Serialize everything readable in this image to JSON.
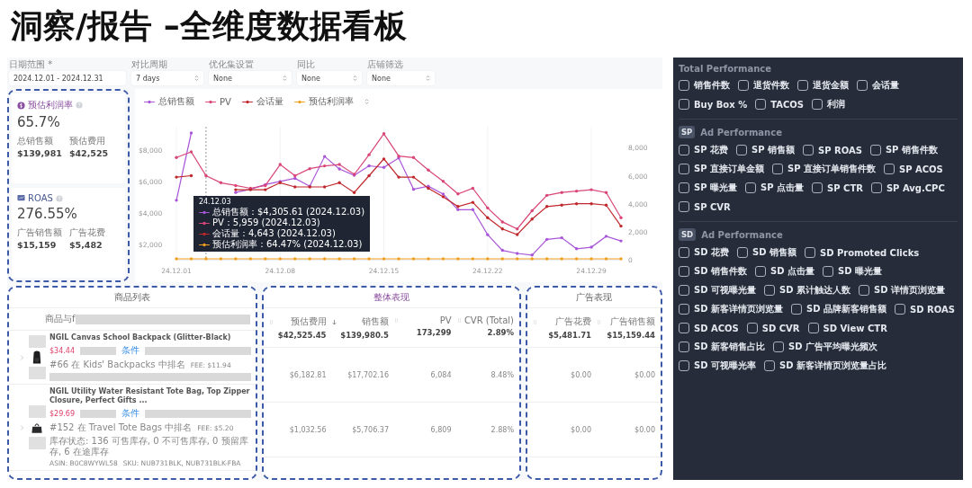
{
  "title": "洞察/报告 –全维度数据看板",
  "filters": [
    {
      "label": "日期范围 *",
      "value": "2024.12.01 - 2024.12.31",
      "dropdown": false
    },
    {
      "label": "对比周期",
      "value": "7 days",
      "dropdown": true
    },
    {
      "label": "优化集设置",
      "value": "None",
      "dropdown": true
    },
    {
      "label": "同比",
      "value": "None",
      "dropdown": true
    },
    {
      "label": "店铺筛选",
      "value": "None",
      "dropdown": true
    }
  ],
  "kpis": [
    {
      "kind": "profit",
      "title": "预估利润率",
      "value": "65.7%",
      "subs": [
        {
          "label": "总销售额",
          "value": "$139,981"
        },
        {
          "label": "预估费用",
          "value": "$42,525"
        }
      ]
    },
    {
      "kind": "roas",
      "title": "ROAS",
      "value": "276.55%",
      "subs": [
        {
          "label": "广告销售额",
          "value": "$15,159"
        },
        {
          "label": "广告花费",
          "value": "$5,482"
        }
      ]
    }
  ],
  "chart": {
    "tooltip": {
      "title": "24.12.03",
      "lines": [
        "总销售额：$4,305.61 (2024.12.03)",
        "PV：5,959 (2024.12.03)",
        "会话量：4,643 (2024.12.03)",
        "预估利润率：64.47% (2024.12.03)"
      ]
    },
    "chart_data": {
      "type": "line",
      "categories": [
        "24.12.01",
        null,
        null,
        null,
        null,
        null,
        null,
        "24.12.08",
        null,
        null,
        null,
        null,
        null,
        null,
        "24.12.15",
        null,
        null,
        null,
        null,
        null,
        null,
        "24.12.22",
        null,
        null,
        null,
        null,
        null,
        null,
        "24.12.29",
        null,
        null
      ],
      "grid": true,
      "ylim": [
        1000,
        9500
      ],
      "yticks": [
        {
          "value": 2000,
          "label": "$2,000"
        },
        {
          "value": 4000,
          "label": "$4,000"
        },
        {
          "value": 6000,
          "label": "$6,000"
        },
        {
          "value": 8000,
          "label": "$8,000"
        }
      ],
      "y2lim": [
        0,
        9500
      ],
      "y2ticks": [
        {
          "value": 0,
          "label": "0"
        },
        {
          "value": 2000,
          "label": "2,000"
        },
        {
          "value": 4000,
          "label": "4,000"
        },
        {
          "value": 6000,
          "label": "6,000"
        },
        {
          "value": 8000,
          "label": "8,000"
        }
      ],
      "series": [
        {
          "name": "总销售额",
          "color": "#a855d8",
          "values": [
            4800,
            9100,
            null,
            null,
            5300,
            5500,
            5800,
            6000,
            6200,
            5700,
            7600,
            6800,
            6400,
            7000,
            6900,
            7500,
            5500,
            5700,
            5200,
            4200,
            4200,
            2600,
            1600,
            1400,
            1300,
            2300,
            2400,
            1700,
            1800,
            2500,
            2200
          ]
        },
        {
          "name": "PV",
          "color": "#d9467a",
          "axis": "y2",
          "values": [
            7300,
            7700,
            6000,
            5500,
            5300,
            5100,
            5300,
            6800,
            6000,
            6500,
            6700,
            6800,
            6100,
            7500,
            9000,
            7400,
            7300,
            6400,
            5600,
            4700,
            5100,
            3700,
            2700,
            2200,
            3500,
            4600,
            4800,
            4900,
            5000,
            4800,
            3000
          ]
        },
        {
          "name": "会话量",
          "color": "#c0282d",
          "axis": "y2",
          "values": [
            5900,
            6000,
            null,
            null,
            5000,
            5000,
            5000,
            5500,
            5200,
            5200,
            5200,
            5500,
            4800,
            6000,
            7200,
            5900,
            5900,
            5100,
            4500,
            3800,
            4100,
            3000,
            2200,
            1800,
            2900,
            3800,
            3900,
            4000,
            4000,
            3900,
            2400
          ]
        },
        {
          "name": "预估利润率",
          "color": "#f0a020",
          "axis": "y2",
          "values": [
            65,
            65,
            65,
            65,
            65,
            65,
            65,
            65,
            65,
            65,
            65,
            65,
            65,
            65,
            65,
            65,
            65,
            65,
            65,
            65,
            65,
            65,
            65,
            65,
            65,
            65,
            65,
            65,
            65,
            65,
            65
          ]
        }
      ]
    }
  },
  "products": {
    "title": "商品列表",
    "column": "商品与f",
    "rows": [
      {
        "kind": "backpack",
        "name": "NGIL Canvas School Backpack (Glitter-Black)",
        "price": "$34.44",
        "tag": "条件",
        "rank": "#66 在 Kids' Backpacks 中排名",
        "fee": "FEE: $11.94"
      },
      {
        "kind": "tote",
        "name": "NGIL Utility Water Resistant Tote Bag, Top Zipper Closure, Perfect Gifts ...",
        "price": "$29.69",
        "tag": "条件",
        "rank": "#152 在 Travel Tote Bags 中排名",
        "fee": "FEE: $5.20",
        "stock": "库存状态: 136 可售库存, 0 不可售库存, 0 预留库存, 6 在途库存",
        "asin": "ASIN: B0C8WYWL58",
        "sku": "SKU: NUB731BLK, NUB731BLK-FBA"
      }
    ]
  },
  "overall": {
    "title": "整体表现",
    "columns": [
      {
        "label": "预估费用",
        "total": "$42,525.45",
        "sorted": false
      },
      {
        "label": "销售额",
        "total": "$139,980.5",
        "sorted": true
      },
      {
        "label": "PV",
        "total": "173,299",
        "sorted": false
      },
      {
        "label": "CVR (Total)",
        "total": "2.89%",
        "sorted": false
      }
    ],
    "rows": [
      [
        "$6,182.81",
        "$17,702.16",
        "6,084",
        "8.48%"
      ],
      [
        "$1,032.56",
        "$5,706.37",
        "6,809",
        "2.88%"
      ]
    ]
  },
  "ads": {
    "title": "广告表现",
    "columns": [
      {
        "label": "广告花费",
        "total": "$5,481.71",
        "sorted": false
      },
      {
        "label": "广告销售额",
        "total": "$15,159.44",
        "sorted": false
      }
    ],
    "rows": [
      [
        "$0.00",
        "$0.00"
      ],
      [
        "$0.00",
        "$0.00"
      ]
    ]
  },
  "panel": [
    {
      "title": "Total Performance",
      "items": [
        {
          "label": "销售件数",
          "checked": false
        },
        {
          "label": "退货件数",
          "checked": false
        },
        {
          "label": "退货金额",
          "checked": false
        },
        {
          "label": "会话量",
          "checked": false
        },
        {
          "label": "Buy Box %",
          "checked": false
        },
        {
          "label": "TACOS",
          "checked": false
        },
        {
          "label": "利润",
          "checked": false
        }
      ]
    },
    {
      "badge": "SP",
      "title": "Ad Performance",
      "items": [
        {
          "label": "SP 花费",
          "checked": false
        },
        {
          "label": "SP 销售额",
          "checked": false
        },
        {
          "label": "SP ROAS",
          "checked": false
        },
        {
          "label": "SP 销售件数",
          "checked": false
        },
        {
          "label": "SP 直接订单金额",
          "checked": false
        },
        {
          "label": "SP 直接订单销售件数",
          "checked": false
        },
        {
          "label": "SP ACOS",
          "checked": false
        },
        {
          "label": "SP 曝光量",
          "checked": false
        },
        {
          "label": "SP 点击量",
          "checked": false
        },
        {
          "label": "SP CTR",
          "checked": false
        },
        {
          "label": "SP Avg.CPC",
          "checked": false
        },
        {
          "label": "SP CVR",
          "checked": false
        }
      ]
    },
    {
      "badge": "SD",
      "title": "Ad Performance",
      "items": [
        {
          "label": "SD 花费",
          "checked": false
        },
        {
          "label": "SD 销售额",
          "checked": false
        },
        {
          "label": "SD Promoted Clicks",
          "checked": false
        },
        {
          "label": "SD 销售件数",
          "checked": false
        },
        {
          "label": "SD 点击量",
          "checked": false
        },
        {
          "label": "SD 曝光量",
          "checked": false
        },
        {
          "label": "SD 可视曝光量",
          "checked": false
        },
        {
          "label": "SD 累计触达人数",
          "checked": false
        },
        {
          "label": "SD 详情页浏览量",
          "checked": false
        },
        {
          "label": "SD 新客详情页浏览量",
          "checked": false
        },
        {
          "label": "SD 品牌新客销售额",
          "checked": false
        },
        {
          "label": "SD ROAS",
          "checked": false
        },
        {
          "label": "SD ACOS",
          "checked": false
        },
        {
          "label": "SD CVR",
          "checked": false
        },
        {
          "label": "SD View CTR",
          "checked": false
        },
        {
          "label": "SD 新客销售占比",
          "checked": false
        },
        {
          "label": "SD 广告平均曝光频次",
          "checked": false
        },
        {
          "label": "SD 可视曝光率",
          "checked": false
        },
        {
          "label": "SD 新客详情页浏览量占比",
          "checked": false
        }
      ]
    }
  ]
}
